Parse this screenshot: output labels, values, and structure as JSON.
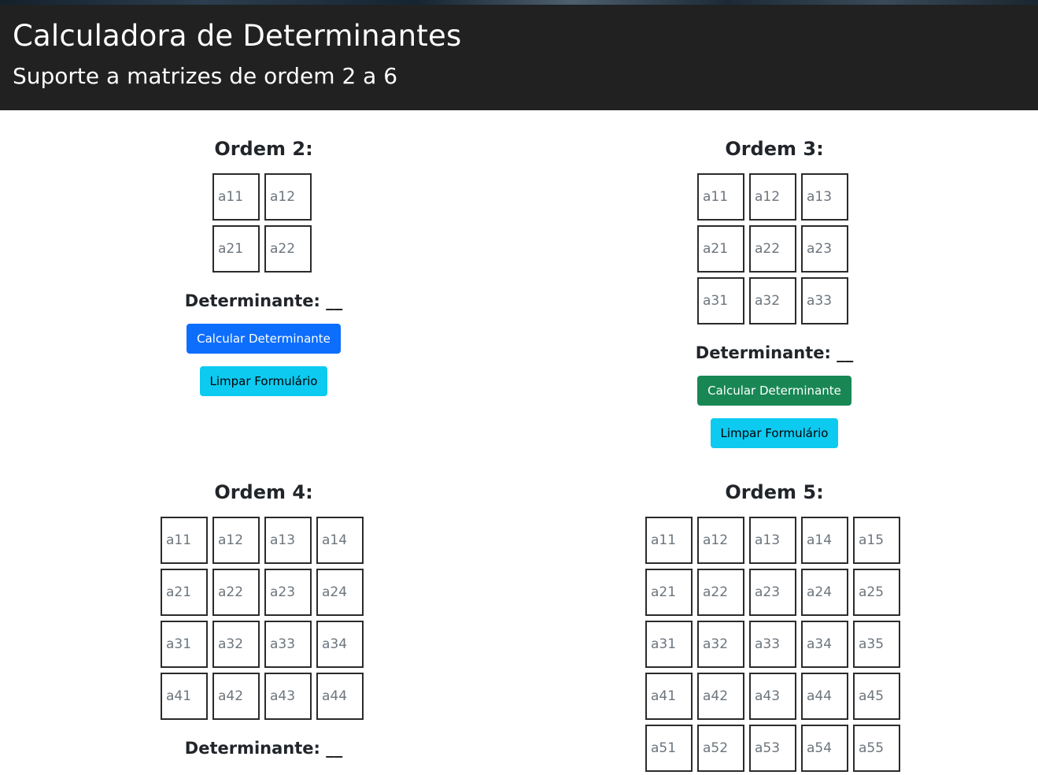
{
  "header": {
    "title": "Calculadora de Determinantes",
    "subtitle": "Suporte a matrizes de ordem 2 a 6"
  },
  "panels": {
    "order2": {
      "title": "Ordem 2:",
      "cells": [
        "a11",
        "a12",
        "a21",
        "a22"
      ],
      "determinant_label": "Determinante: __",
      "calc_button": "Calcular Determinante",
      "clear_button": "Limpar Formulário"
    },
    "order3": {
      "title": "Ordem 3:",
      "cells": [
        "a11",
        "a12",
        "a13",
        "a21",
        "a22",
        "a23",
        "a31",
        "a32",
        "a33"
      ],
      "determinant_label": "Determinante: __",
      "calc_button": "Calcular Determinante",
      "clear_button": "Limpar Formulário"
    },
    "order4": {
      "title": "Ordem 4:",
      "cells": [
        "a11",
        "a12",
        "a13",
        "a14",
        "a21",
        "a22",
        "a23",
        "a24",
        "a31",
        "a32",
        "a33",
        "a34",
        "a41",
        "a42",
        "a43",
        "a44"
      ],
      "determinant_label": "Determinante: __"
    },
    "order5": {
      "title": "Ordem 5:",
      "cells": [
        "a11",
        "a12",
        "a13",
        "a14",
        "a15",
        "a21",
        "a22",
        "a23",
        "a24",
        "a25",
        "a31",
        "a32",
        "a33",
        "a34",
        "a35",
        "a41",
        "a42",
        "a43",
        "a44",
        "a45",
        "a51",
        "a52",
        "a53",
        "a54",
        "a55"
      ]
    }
  },
  "colors": {
    "header_bg": "#212121",
    "calc_blue": "#0d6efd",
    "calc_green": "#198754",
    "clear_cyan": "#0dcaf0"
  }
}
